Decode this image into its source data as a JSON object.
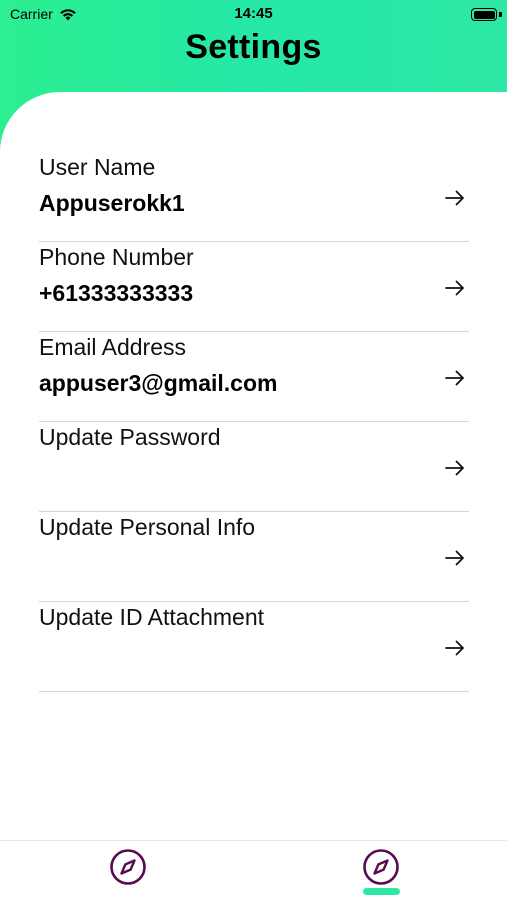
{
  "status_bar": {
    "carrier": "Carrier",
    "time": "14:45"
  },
  "header": {
    "title": "Settings"
  },
  "settings": [
    {
      "label": "User Name",
      "value": "Appuserokk1"
    },
    {
      "label": "Phone Number",
      "value": "+61333333333"
    },
    {
      "label": "Email Address",
      "value": "appuser3@gmail.com"
    },
    {
      "label": "Update Password",
      "value": ""
    },
    {
      "label": "Update Personal Info",
      "value": ""
    },
    {
      "label": "Update ID Attachment",
      "value": ""
    }
  ],
  "icons": {
    "row_action": "arrow-right-icon",
    "tab": "compass-icon",
    "wifi": "wifi-icon",
    "battery": "battery-icon"
  },
  "colors": {
    "header_gradient_start": "#2bef8f",
    "header_gradient_end": "#2de8a4",
    "tab_icon": "#5a0a52",
    "tab_indicator": "#2de8a4"
  },
  "tab_bar": {
    "active_index": 1,
    "tab_count": 2
  }
}
